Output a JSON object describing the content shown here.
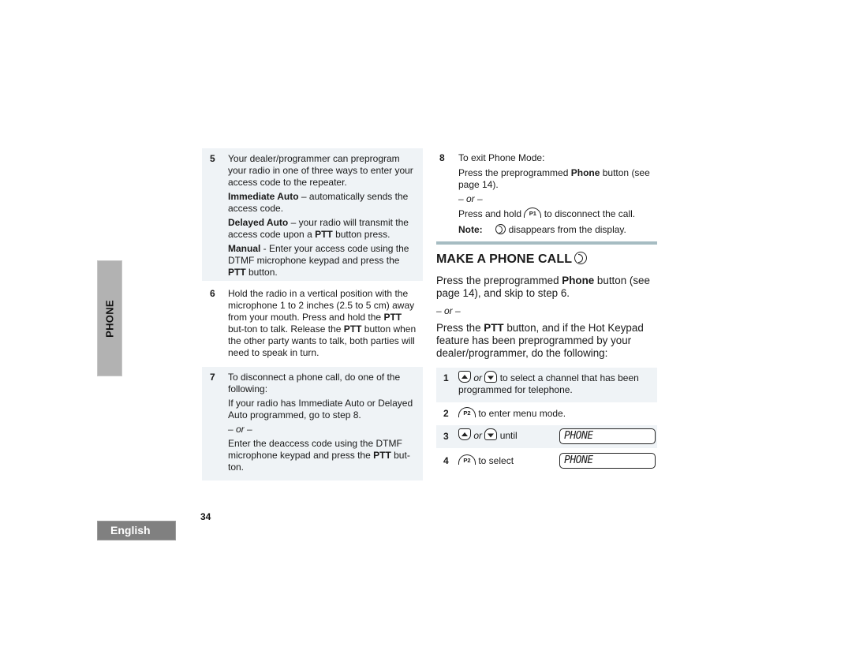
{
  "side_tab": {
    "label": "PHONE"
  },
  "language_tab": {
    "label": "English"
  },
  "page_number": "34",
  "left_column": {
    "step5": {
      "number": "5",
      "intro": "Your dealer/programmer can preprogram your radio in one of three ways to enter your access code to the repeater.",
      "options": [
        {
          "term": "Immediate Auto",
          "text": " – automatically sends the access code."
        },
        {
          "term": "Delayed Auto",
          "text_before": " – your radio will transmit the access code upon a ",
          "bold": "PTT",
          "text_after": " button press."
        },
        {
          "term": "Manual",
          "text_before": " - Enter your access code using the DTMF microphone keypad and press the ",
          "bold": "PTT",
          "text_after": " button."
        }
      ]
    },
    "step6": {
      "number": "6",
      "text_1": "Hold the radio in a vertical position with the microphone 1 to 2 inches (2.5 to 5 cm) away from your mouth. Press and hold the ",
      "bold_1": "PTT",
      "text_2": " but-ton to talk. Release the ",
      "bold_2": "PTT",
      "text_3": " button when the other party wants to talk, both parties will need to speak in turn."
    },
    "step7": {
      "number": "7",
      "intro": "To disconnect a phone call, do one of the following:",
      "option_a": "If your radio has Immediate Auto or Delayed Auto programmed, go to step 8.",
      "or": "– or –",
      "option_b_before": "Enter the deaccess code using the DTMF microphone keypad and press the ",
      "option_b_bold": "PTT",
      "option_b_after": " but-ton."
    }
  },
  "right_column": {
    "step8": {
      "number": "8",
      "intro": "To exit Phone Mode:",
      "option_a_before": "Press the preprogrammed ",
      "option_a_bold": "Phone",
      "option_a_after": " button (see page 14).",
      "or": "– or –",
      "option_b_before": "Press and hold ",
      "option_b_key": "P1",
      "option_b_after": " to disconnect the call.",
      "note_label": "Note:",
      "note_text": " disappears from the display."
    },
    "section": {
      "title": "MAKE A PHONE CALL",
      "title_icon": "phone-icon",
      "para1_before": "Press the preprogrammed ",
      "para1_bold": "Phone",
      "para1_after": " button (see page 14), and skip to step 6.",
      "or": "– or –",
      "para2_before": "Press the ",
      "para2_bold": "PTT",
      "para2_after": " button, and if the Hot Keypad feature has been preprogrammed by your dealer/programmer, do the following:"
    },
    "steps": [
      {
        "number": "1",
        "or": "or",
        "text": " to select a channel that has been programmed for telephone."
      },
      {
        "number": "2",
        "key": "P2",
        "text": " to enter menu mode."
      },
      {
        "number": "3",
        "or": "or",
        "text": " until",
        "display": "PHONE"
      },
      {
        "number": "4",
        "key": "P2",
        "text": " to select",
        "display": "PHONE"
      }
    ]
  }
}
